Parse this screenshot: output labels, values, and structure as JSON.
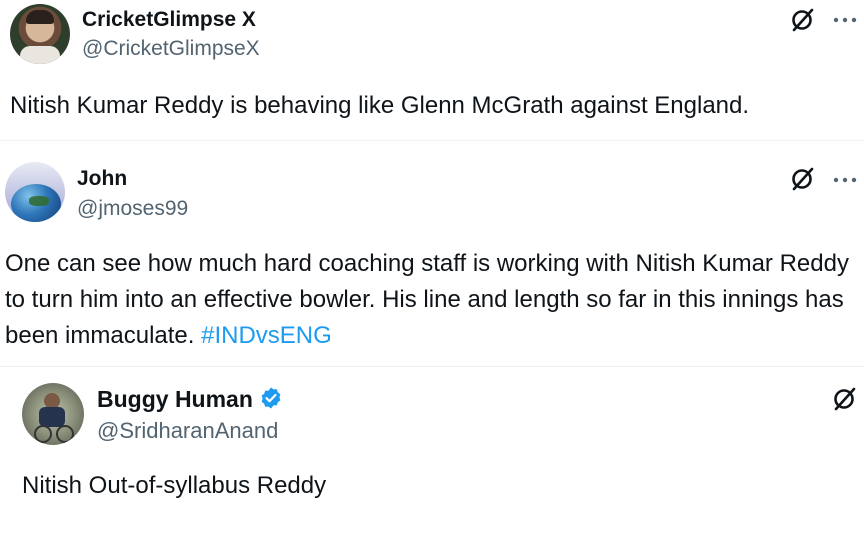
{
  "tweets": [
    {
      "name": "CricketGlimpse X",
      "handle": "@CricketGlimpseX",
      "text": "Nitish Kumar Reddy is behaving like Glenn McGrath against England.",
      "hashtag": ""
    },
    {
      "name": "John",
      "handle": "@jmoses99",
      "text": "One can see how much hard coaching staff is working with Nitish Kumar Reddy to turn him into an effective bowler. His line and length so far in this innings has been immaculate.",
      "hashtag": "#INDvsENG"
    },
    {
      "name": "Buggy Human",
      "handle": "@SridharanAnand",
      "text": "Nitish Out-of-syllabus Reddy",
      "hashtag": "",
      "verified": true
    }
  ],
  "icons": {
    "grok": "grok-icon",
    "more": "more-icon",
    "verified": "verified-badge-icon"
  },
  "colors": {
    "text": "#0f1419",
    "handle": "#536471",
    "hashtag": "#1d9bf0",
    "verified": "#1d9bf0"
  }
}
